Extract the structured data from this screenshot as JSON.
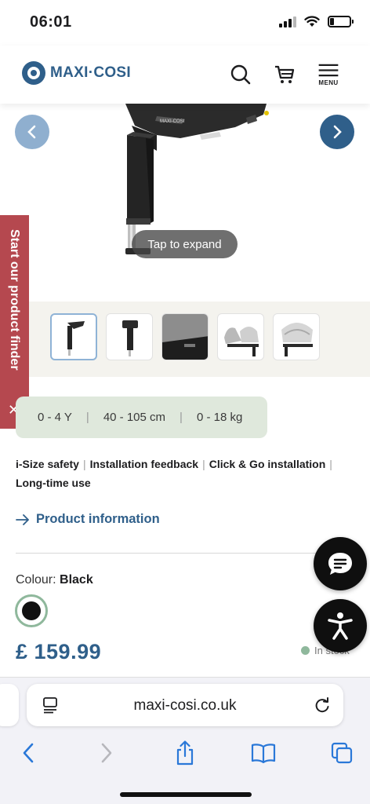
{
  "status_bar": {
    "time": "06:01"
  },
  "header": {
    "logo_text": "MAXI·COSI",
    "menu_label": "MENU",
    "icons": [
      "search-icon",
      "cart-icon",
      "hamburger-menu-icon"
    ]
  },
  "gallery": {
    "expand_label": "Tap to expand",
    "thumbnails": [
      "base-front",
      "base-side",
      "base-closeup",
      "base-with-seat",
      "base-with-carrier"
    ]
  },
  "side_tab": {
    "label": "Start our product finder",
    "close": "✕"
  },
  "specs": {
    "age": "0 - 4 Y",
    "height": "40 - 105 cm",
    "weight": "0 - 18 kg"
  },
  "features": [
    "i-Size safety",
    "Installation feedback",
    "Click & Go installation",
    "Long-time use"
  ],
  "product_info_link": "Product information",
  "colour": {
    "label": "Colour:",
    "value": "Black"
  },
  "price": "£  159.99",
  "stock": "In stock",
  "browser": {
    "url": "maxi-cosi.co.uk"
  },
  "colors": {
    "brand": "#2f5f8a",
    "side_tab": "#b5484f",
    "spec_bg": "#dfe8dc",
    "swatch_ring": "#8fb89c"
  }
}
